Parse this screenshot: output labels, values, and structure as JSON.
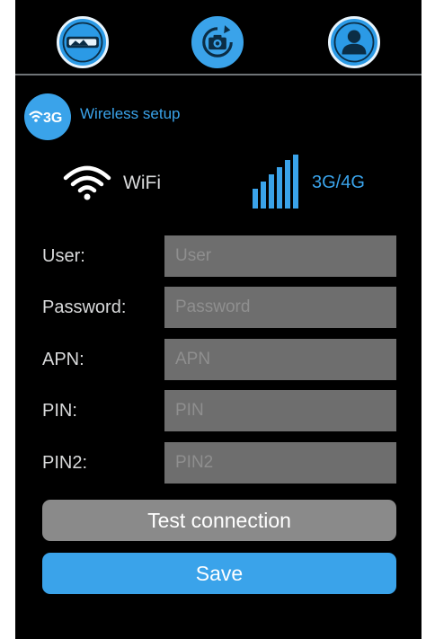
{
  "nav": {
    "items": [
      {
        "icon": "gallery-icon",
        "active": false
      },
      {
        "icon": "camera-rotate-icon",
        "active": true
      },
      {
        "icon": "user-icon",
        "active": false
      }
    ]
  },
  "section": {
    "badge_text": "3G",
    "badge_icon": "wifi-icon",
    "title": "Wireless setup"
  },
  "connection_types": {
    "wifi_label": "WiFi",
    "mobile_label": "3G/4G",
    "selected": "3G/4G"
  },
  "form": {
    "fields": [
      {
        "label": "User:",
        "placeholder": "User",
        "value": ""
      },
      {
        "label": "Password:",
        "placeholder": "Password",
        "value": ""
      },
      {
        "label": "APN:",
        "placeholder": "APN",
        "value": ""
      },
      {
        "label": "PIN:",
        "placeholder": "PIN",
        "value": ""
      },
      {
        "label": "PIN2:",
        "placeholder": "PIN2",
        "value": ""
      }
    ]
  },
  "actions": {
    "test_label": "Test connection",
    "save_label": "Save"
  },
  "colors": {
    "accent": "#3aa3ea",
    "background": "#000000",
    "input_bg": "#6e6e6e",
    "test_button": "#8a8a8a"
  }
}
